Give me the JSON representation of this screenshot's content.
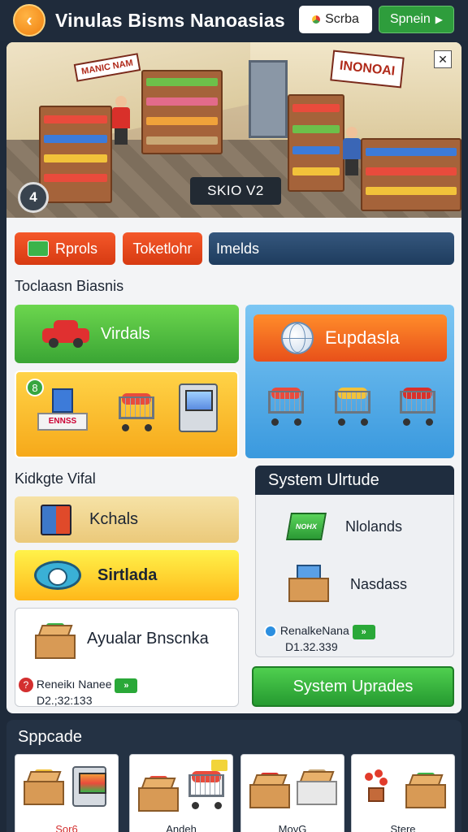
{
  "header": {
    "back_icon": "chevron-left-icon",
    "title": "Vinulas Bisms Nanoasias",
    "button1_label": "Scrba",
    "button2_label": "Spnein",
    "button2_icon": "play-arrow-icon"
  },
  "hero": {
    "signs": [
      "MANIC NAM",
      "INONOAI"
    ],
    "badge": "SKIO V2",
    "close_icon": "close-icon",
    "info_icon": "info-icon",
    "info_glyph": "4"
  },
  "tabs": [
    {
      "label": "Rprols",
      "color": "#e84a1e"
    },
    {
      "label": "Toketlohr",
      "color": "#e84a1e"
    },
    {
      "label": "Imelds",
      "color": "#2a4a70"
    }
  ],
  "section1": {
    "label": "Toclaasn Biasnis",
    "green_card_label": "Virdals",
    "yellow_card_badge": "8",
    "yellow_card_sign": "ENNSS",
    "blue_card_button": "Eupdasla"
  },
  "section2": {
    "label": "Kidkgte Vifal",
    "cards": [
      {
        "label": "Kchals"
      },
      {
        "label": "Sirtlada"
      },
      {
        "label": "Ayualar Bnscnka"
      }
    ],
    "info_name": "Reneikı Nanee",
    "info_value": "D2.;32:133",
    "info_badge": "»"
  },
  "system": {
    "title": "System Ulrtude",
    "rows": [
      {
        "label": "Nlolands",
        "tile": "NOHX"
      },
      {
        "label": "Nasdass"
      }
    ],
    "info_name": "RenalkeNana",
    "info_value": "D1.32.339",
    "info_badge": "»",
    "button": "System Uprades"
  },
  "bottom": {
    "title": "Sppcade",
    "tiles": [
      {
        "caption": "Sor6"
      },
      {
        "caption": "Andeh"
      },
      {
        "caption": "MoyG"
      },
      {
        "caption": "Stere"
      }
    ]
  }
}
